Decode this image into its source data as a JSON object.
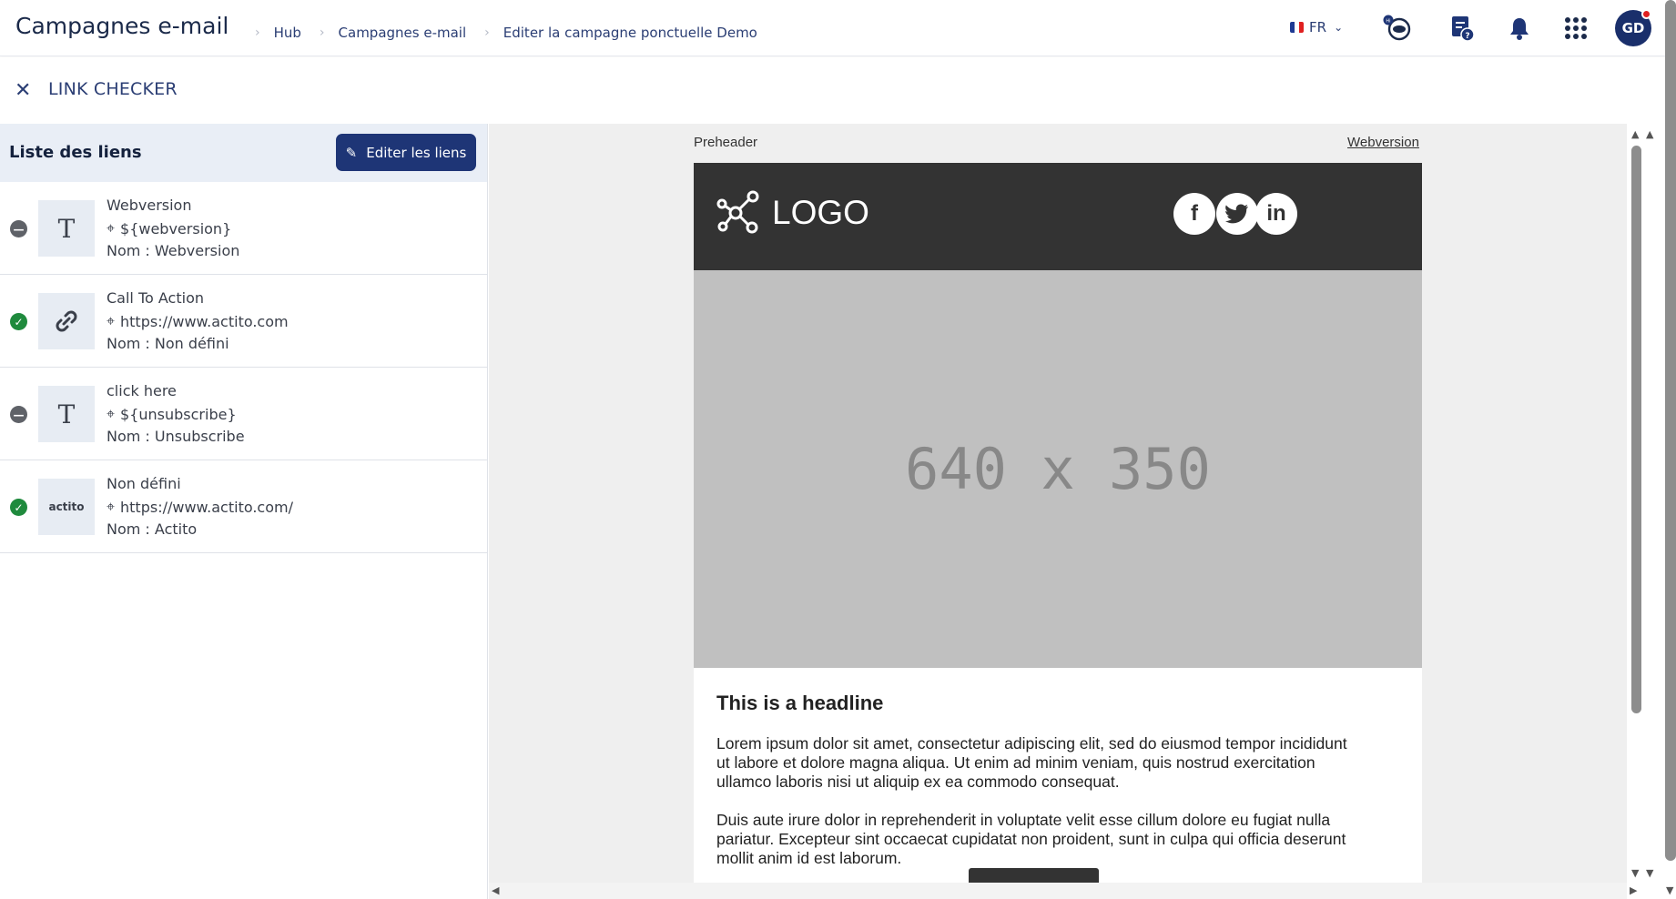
{
  "header": {
    "app_title": "Campagnes e-mail",
    "breadcrumbs": [
      "Hub",
      "Campagnes e-mail",
      "Editer la campagne ponctuelle Demo"
    ],
    "language": "FR",
    "avatar_initials": "GD"
  },
  "subheader": {
    "title": "LINK CHECKER"
  },
  "links_panel": {
    "title": "Liste des liens",
    "edit_button_label": "Editer les liens",
    "items": [
      {
        "status": "neutral",
        "thumb": "T",
        "name": "Webversion",
        "url": "${webversion}",
        "nom": "Nom : Webversion"
      },
      {
        "status": "ok",
        "thumb": "link",
        "name": "Call To Action",
        "url": "https://www.actito.com",
        "nom": "Nom : Non défini"
      },
      {
        "status": "neutral",
        "thumb": "T",
        "name": "click here",
        "url": "${unsubscribe}",
        "nom": "Nom : Unsubscribe"
      },
      {
        "status": "ok",
        "thumb": "actito",
        "name": "Non défini",
        "url": "https://www.actito.com/",
        "nom": "Nom : Actito"
      }
    ]
  },
  "preview": {
    "preheader": "Preheader",
    "webversion": "Webversion",
    "logo_text": "LOGO",
    "social": [
      "f",
      "twitter",
      "in"
    ],
    "hero_text": "640 x 350",
    "headline": "This is a headline",
    "paragraph_1": "Lorem ipsum dolor sit amet, consectetur adipiscing elit, sed do eiusmod tempor incididunt ut labore et dolore magna aliqua. Ut enim ad minim veniam, quis nostrud exercitation ullamco laboris nisi ut aliquip ex ea commodo consequat.",
    "paragraph_2": "Duis aute irure dolor in reprehenderit in voluptate velit esse cillum dolore eu fugiat nulla pariatur. Excepteur sint occaecat cupidatat non proident, sunt in culpa qui officia deserunt mollit anim id est laborum."
  },
  "colors": {
    "primary": "#1e3576",
    "success": "#1f8a3d",
    "neutral": "#5f6268",
    "notification": "#e02020"
  },
  "thumb_text": {
    "t": "T",
    "actito": "actito"
  }
}
